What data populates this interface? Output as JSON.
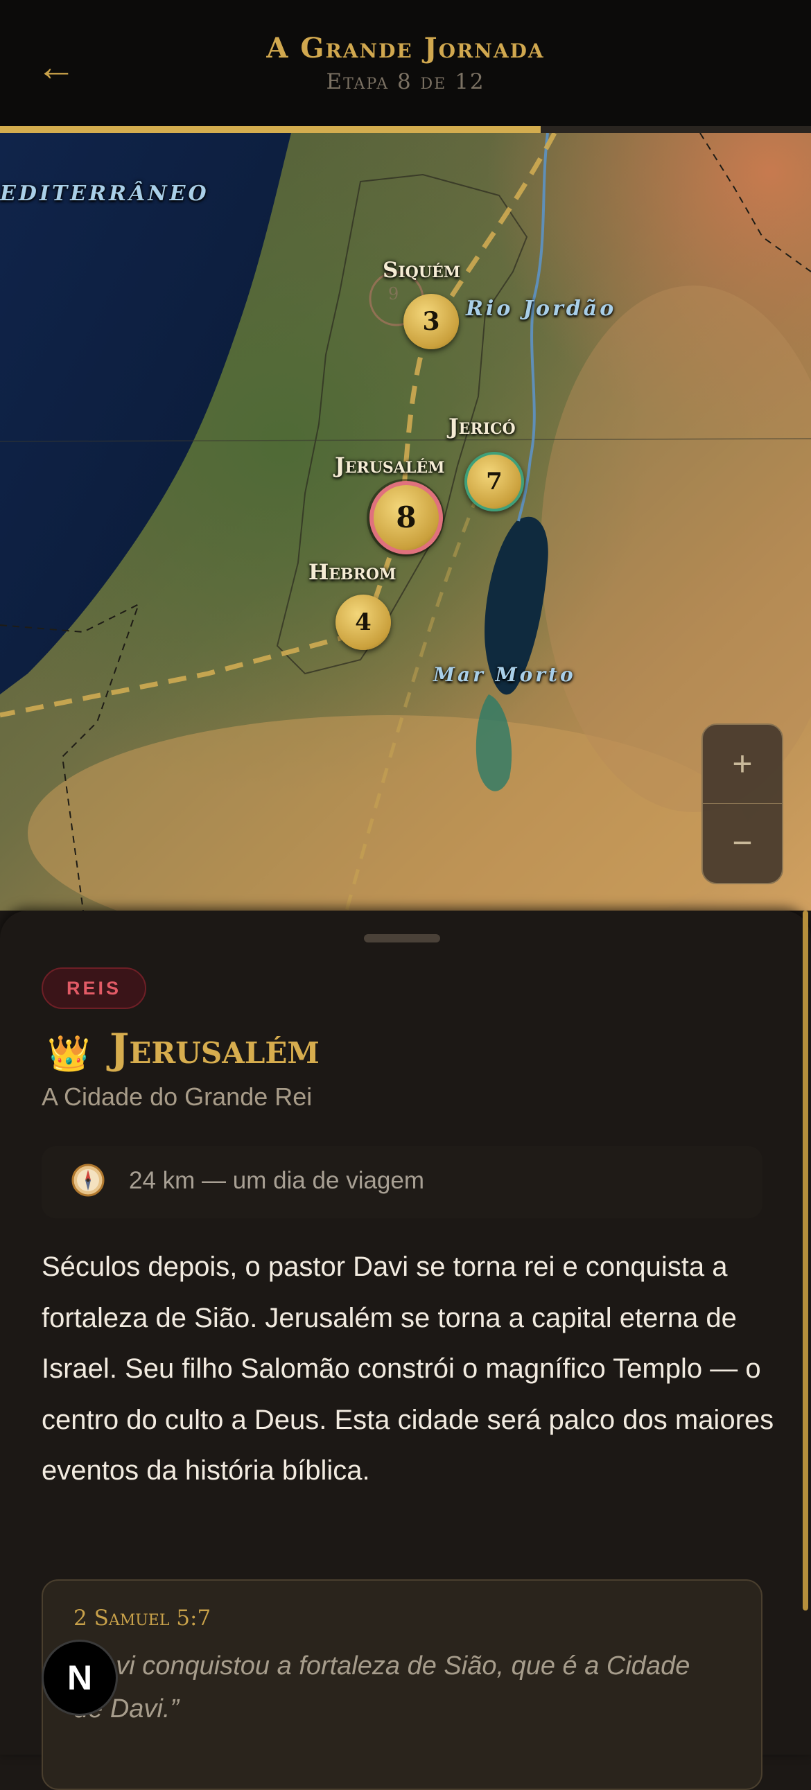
{
  "header": {
    "back_icon": "arrow-left-icon",
    "title": "A Grande Jornada",
    "subtitle": "Etapa 8 de 12",
    "progress": 0.667,
    "accent": "#d4ad4f"
  },
  "map": {
    "sea_label": "EDITERRÂNEO",
    "river_label": "Rio Jordão",
    "dead_sea_label": "Mar Morto",
    "places": [
      {
        "name": "Siquém",
        "stop": "3",
        "faded_stop": "9"
      },
      {
        "name": "Jericó",
        "stop": "7"
      },
      {
        "name": "Jerusalém",
        "stop": "8",
        "current": true
      },
      {
        "name": "Hebrom",
        "stop": "4"
      }
    ],
    "zoom_in": "+",
    "zoom_out": "−"
  },
  "sheet": {
    "era": "REIS",
    "era_color": "#e25b66",
    "icon": "crown-icon",
    "crown": "👑",
    "place": "Jerusalém",
    "tagline": "A Cidade do Grande Rei",
    "distance_icon": "compass-icon",
    "distance": "24 km — um dia de viagem",
    "body": "Séculos depois, o pastor Davi se torna rei e conquista a fortaleza de Sião. Jerusalém se torna a capital eterna de Israel. Seu filho Salomão constrói o magnífico Templo — o centro do culto a Deus. Esta cidade será palco dos maiores eventos da história bíblica.",
    "verse_ref": "2 Samuel 5:7",
    "verse_text": "“Davi conquistou a fortaleza de Sião, que é a Cidade de Davi.”"
  },
  "fab": {
    "label": "N"
  }
}
